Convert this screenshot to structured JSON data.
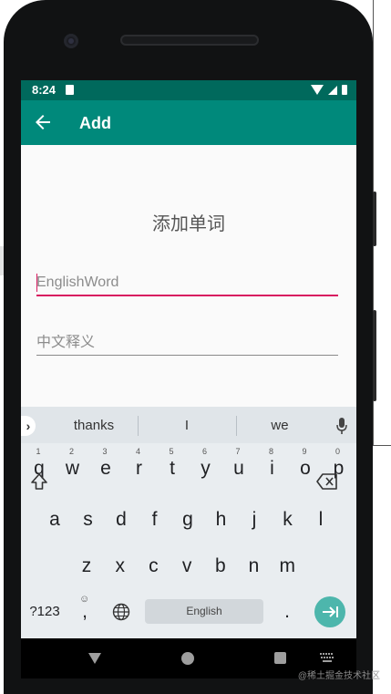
{
  "status_bar": {
    "time": "8:24"
  },
  "app_bar": {
    "title": "Add",
    "back_icon": "arrow-left-icon"
  },
  "form": {
    "heading": "添加单词",
    "english_placeholder": "EnglishWord",
    "chinese_placeholder": "中文释义"
  },
  "keyboard": {
    "suggestions": [
      "thanks",
      "I",
      "we"
    ],
    "expand_symbol": "›",
    "row1": [
      {
        "k": "q",
        "h": "1"
      },
      {
        "k": "w",
        "h": "2"
      },
      {
        "k": "e",
        "h": "3"
      },
      {
        "k": "r",
        "h": "4"
      },
      {
        "k": "t",
        "h": "5"
      },
      {
        "k": "y",
        "h": "6"
      },
      {
        "k": "u",
        "h": "7"
      },
      {
        "k": "i",
        "h": "8"
      },
      {
        "k": "o",
        "h": "9"
      },
      {
        "k": "p",
        "h": "0"
      }
    ],
    "row2": [
      "a",
      "s",
      "d",
      "f",
      "g",
      "h",
      "j",
      "k",
      "l"
    ],
    "row3": [
      "z",
      "x",
      "c",
      "v",
      "b",
      "n",
      "m"
    ],
    "symbols_label": "?123",
    "comma_label": ",",
    "period_label": ".",
    "space_label": "English",
    "shift_icon": "shift-icon",
    "backspace_icon": "backspace-icon",
    "globe_icon": "globe-icon",
    "emoji_icon": "emoji-icon",
    "enter_icon": "enter-icon",
    "accent_color": "#4db6ac"
  },
  "colors": {
    "status_bar": "#00695c",
    "app_bar": "#00897b",
    "focus_underline": "#d81b60"
  },
  "watermark": "@稀土掘金技术社区"
}
